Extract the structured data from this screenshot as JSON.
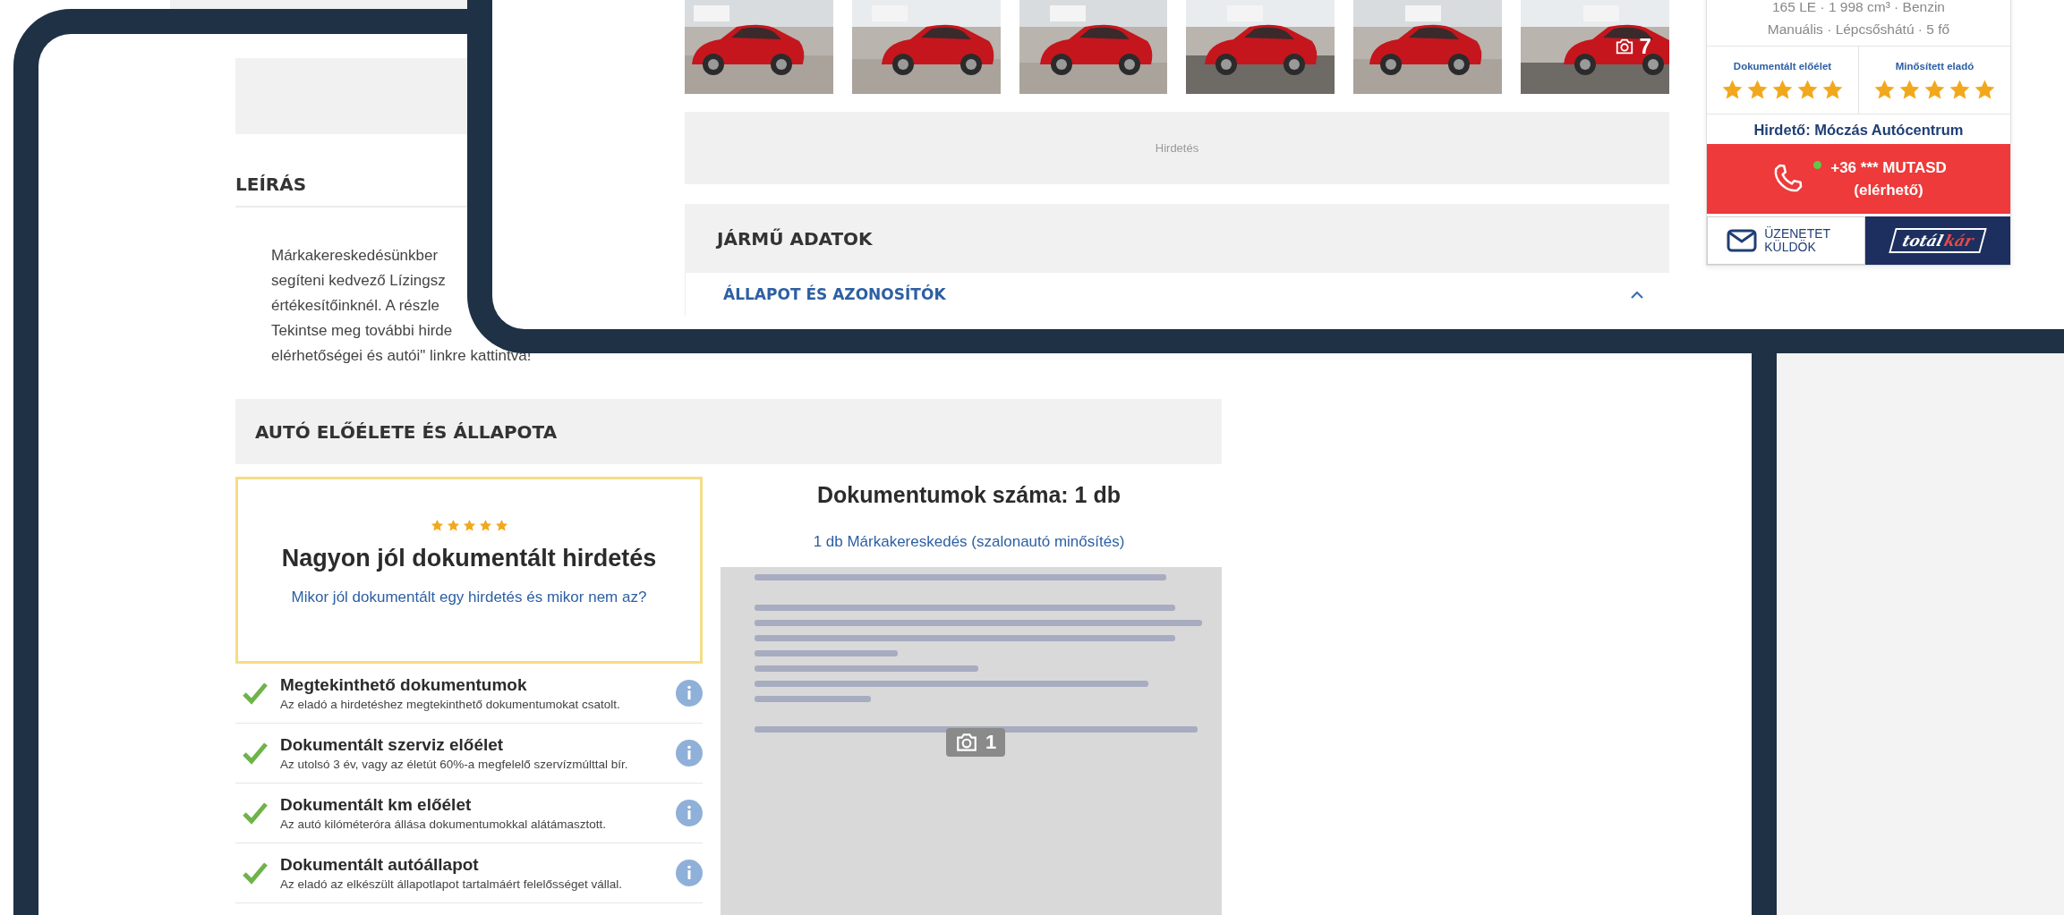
{
  "gallery": {
    "more_count": "7"
  },
  "ad_banner": {
    "label": "Hirdetés"
  },
  "vehicle_data": {
    "title": "JÁRMŰ ADATOK",
    "sections": [
      {
        "title": "ÁLLAPOT ÉS AZONOSÍTÓK",
        "expanded": true
      }
    ]
  },
  "seller_card": {
    "specs": [
      "165 LE · 1 998 cm³ · Benzin",
      "Manuális · Lépcsőshátú · 5 fő"
    ],
    "ratings": [
      {
        "label": "Dokumentált előélet",
        "stars": 5
      },
      {
        "label": "Minősített eladó",
        "stars": 5
      }
    ],
    "advertiser": "Hirdető: Móczás Autócentrum",
    "call_button": {
      "number": "+36 *** MUTASD",
      "status": "(elérhető)",
      "available": true
    },
    "message_button": "ÜZENETET KÜLDÖK",
    "logo": {
      "part_1": "totál",
      "part_2": "kár"
    }
  },
  "description": {
    "title": "LEÍRÁS",
    "lines": [
      "Márkakereskedésünkber",
      "segíteni kedvező Lízingsz",
      "értékesítőinknél. A részle",
      "Tekintse meg további hirde",
      "elérhetőségei és autói\" linkre kattintva!"
    ]
  },
  "history": {
    "title": "AUTÓ ELŐÉLETE ÉS ÁLLAPOTA",
    "summary": {
      "stars": 5,
      "title": "Nagyon jól dokumentált hirdetés",
      "link": "Mikor jól dokumentált egy hirdetés és mikor nem az?"
    },
    "checks": [
      {
        "title": "Megtekinthető dokumentumok",
        "text": "Az eladó a hirdetéshez megtekinthető dokumentumokat csatolt.",
        "checked": true
      },
      {
        "title": "Dokumentált szerviz előélet",
        "text": "Az utolsó 3 év, vagy az életút 60%-a megfelelő szervízmúlttal bír.",
        "checked": true
      },
      {
        "title": "Dokumentált km előélet",
        "text": "Az autó kilóméteróra állása dokumentumokkal alátámasztott.",
        "checked": true
      },
      {
        "title": "Dokumentált autóállapot",
        "text": "Az eladó az elkészült állapotlapot tartalmáért felelősséget vállal.",
        "checked": true
      }
    ],
    "documents": {
      "title": "Dokumentumok száma: 1 db",
      "link": "1 db Márkakereskedés (szalonautó minősítés)",
      "photo_count": "1"
    }
  }
}
